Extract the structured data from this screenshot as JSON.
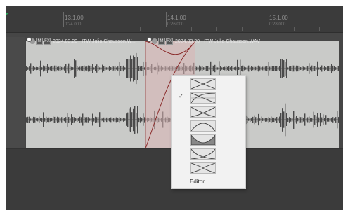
{
  "ruler": {
    "markers": [
      {
        "position": "13.1.00",
        "time": "0:24.000"
      },
      {
        "position": "14.1.00",
        "time": "0:26.000"
      },
      {
        "position": "15.1.00",
        "time": "0:28.000"
      }
    ]
  },
  "items": [
    {
      "name": "2024.03.20 - ITW Julia Chausson.W...",
      "badges": [
        "M",
        "FX"
      ]
    },
    {
      "name": "2024.03.20 - ITW Julia Chausson.WAV",
      "badges": [
        "M",
        "FX"
      ]
    }
  ],
  "crossfade_menu": {
    "selected_index": 0,
    "shapes": [
      "crossfade-linear-x",
      "crossfade-shape-2",
      "crossfade-shape-3",
      "crossfade-arch",
      "crossfade-bowl",
      "crossfade-shape-6",
      "crossfade-shape-7"
    ],
    "editor_label": "Editor..."
  },
  "colors": {
    "crossfade_fill": "#d9b5b5",
    "crossfade_line": "#8a2a2a",
    "waveform": "#4a4a4a"
  }
}
